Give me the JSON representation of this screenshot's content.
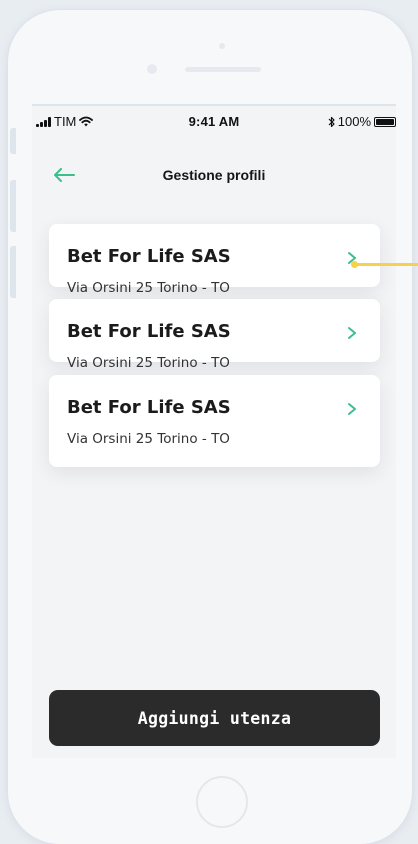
{
  "status_bar": {
    "carrier": "TIM",
    "time": "9:41 AM",
    "battery": "100%"
  },
  "header": {
    "title": "Gestione profili",
    "back_icon": "arrow-left-icon"
  },
  "profiles": [
    {
      "name": "Bet For Life SAS",
      "address": "Via Orsini 25 Torino - TO"
    },
    {
      "name": "Bet For Life SAS",
      "address": "Via Orsini 25 Torino - TO"
    },
    {
      "name": "Bet For Life SAS",
      "address": "Via Orsini 25 Torino - TO"
    }
  ],
  "add_button": {
    "label": "Aggiungi utenza"
  },
  "colors": {
    "accent_green": "#3dbf8c",
    "button_dark": "#2b2b2b",
    "annotation_yellow": "#f5d24a",
    "background": "#f3f4f6"
  }
}
